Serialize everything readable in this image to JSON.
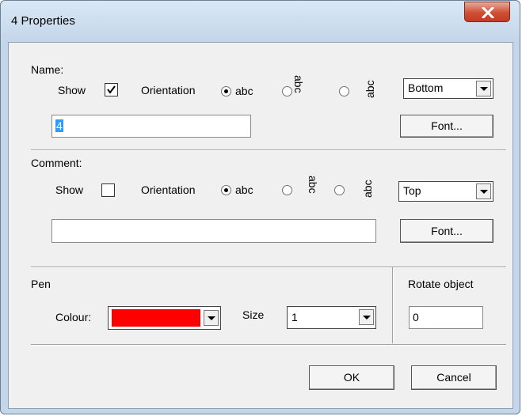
{
  "window": {
    "title": "4 Properties"
  },
  "name_section": {
    "heading": "Name:",
    "show_label": "Show",
    "show_checked": true,
    "orientation_label": "Orientation",
    "orientation_options": [
      "abc",
      "abc",
      "abc"
    ],
    "orientation_selected": 0,
    "position_value": "Bottom",
    "text_value": "4",
    "font_button": "Font..."
  },
  "comment_section": {
    "heading": "Comment:",
    "show_label": "Show",
    "show_checked": false,
    "orientation_label": "Orientation",
    "orientation_options": [
      "abc",
      "abc",
      "abc"
    ],
    "orientation_selected": 0,
    "position_value": "Top",
    "text_value": "",
    "font_button": "Font..."
  },
  "pen_section": {
    "heading": "Pen",
    "colour_label": "Colour:",
    "colour_value": "#ff0000",
    "size_label": "Size",
    "size_value": "1"
  },
  "rotate_section": {
    "heading": "Rotate object",
    "value": "0"
  },
  "buttons": {
    "ok": "OK",
    "cancel": "Cancel"
  },
  "icons": {
    "close": "close-x-icon",
    "checkmark": "checkmark-icon"
  }
}
